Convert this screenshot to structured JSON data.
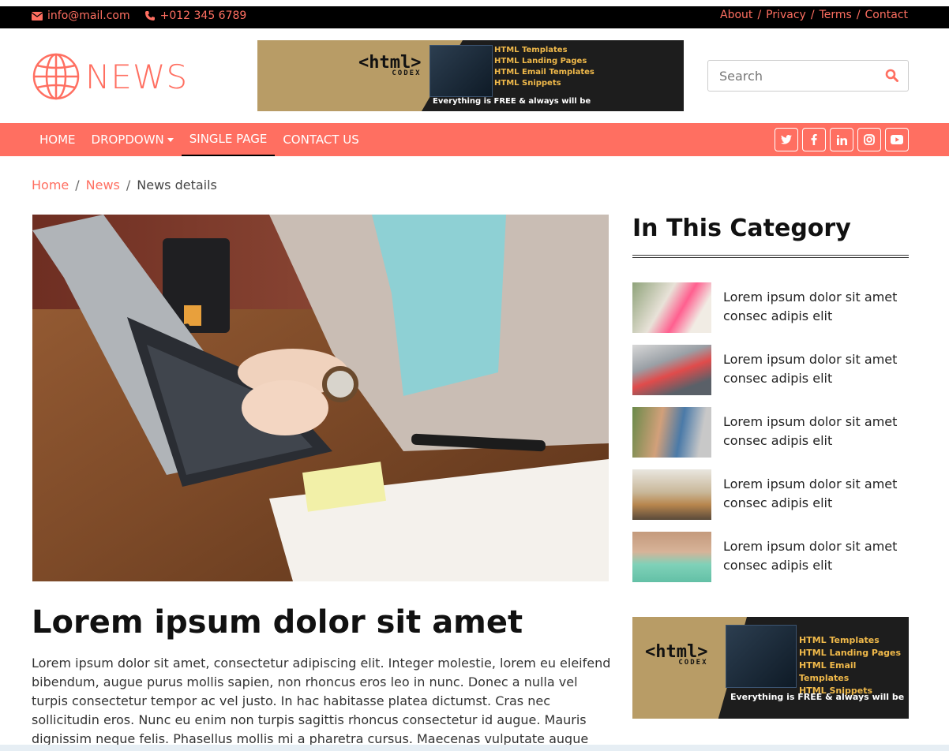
{
  "topbar": {
    "email": "info@mail.com",
    "phone": "+012 345 6789",
    "links": [
      "About",
      "Privacy",
      "Terms",
      "Contact"
    ],
    "separator": "/"
  },
  "header": {
    "logo_text": "NEWS",
    "banner": {
      "brand": "<html>",
      "brand_sub": "CODEX",
      "list": [
        "HTML Templates",
        "HTML Landing Pages",
        "HTML Email Templates",
        "HTML Snippets"
      ],
      "tagline": "Everything is FREE & always will be"
    },
    "search": {
      "placeholder": "Search"
    }
  },
  "nav": {
    "items": [
      {
        "label": "HOME"
      },
      {
        "label": "DROPDOWN"
      },
      {
        "label": "SINGLE PAGE"
      },
      {
        "label": "CONTACT US"
      }
    ],
    "social": [
      "twitter-icon",
      "facebook-icon",
      "linkedin-icon",
      "instagram-icon",
      "youtube-icon"
    ]
  },
  "breadcrumb": {
    "items": [
      "Home",
      "News",
      "News details"
    ],
    "separator": "/"
  },
  "article": {
    "title": "Lorem ipsum dolor sit amet",
    "body": "Lorem ipsum dolor sit amet, consectetur adipiscing elit. Integer molestie, lorem eu eleifend bibendum, augue purus mollis sapien, non rhoncus eros leo in nunc. Donec a nulla vel turpis consectetur tempor ac vel justo. In hac habitasse platea dictumst. Cras nec sollicitudin eros. Nunc eu enim non turpis sagittis rhoncus consectetur id augue. Mauris dignissim neque felis. Phasellus mollis mi a pharetra cursus. Maecenas vulputate augue"
  },
  "sidebar": {
    "title": "In This Category",
    "items": [
      {
        "text": "Lorem ipsum dolor sit amet consec adipis elit"
      },
      {
        "text": "Lorem ipsum dolor sit amet consec adipis elit"
      },
      {
        "text": "Lorem ipsum dolor sit amet consec adipis elit"
      },
      {
        "text": "Lorem ipsum dolor sit amet consec adipis elit"
      },
      {
        "text": "Lorem ipsum dolor sit amet consec adipis elit"
      }
    ],
    "banner": {
      "brand": "<html>",
      "brand_sub": "CODEX",
      "list": [
        "HTML Templates",
        "HTML Landing Pages",
        "HTML Email Templates",
        "HTML Snippets"
      ],
      "tagline": "Everything is FREE & always will be"
    }
  },
  "colors": {
    "accent": "#ff6f61",
    "topbar": "#000000"
  }
}
